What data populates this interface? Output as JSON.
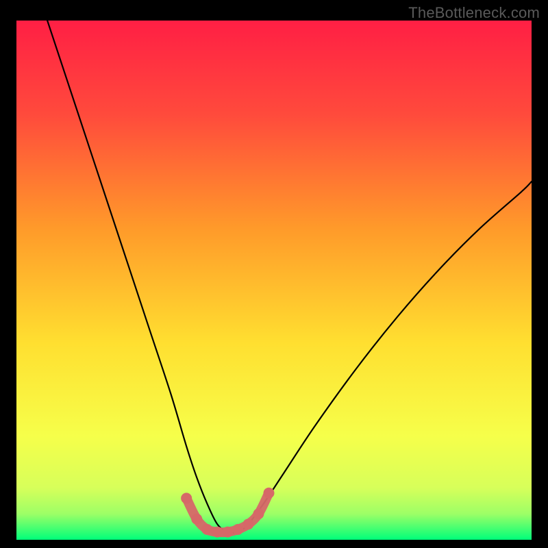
{
  "watermark": "TheBottleneck.com",
  "chart_data": {
    "type": "line",
    "title": "",
    "xlabel": "",
    "ylabel": "",
    "xlim": [
      0,
      100
    ],
    "ylim": [
      0,
      100
    ],
    "grid": false,
    "series": [
      {
        "name": "bottleneck-curve",
        "x": [
          6,
          10,
          14,
          18,
          22,
          26,
          30,
          33,
          35,
          37,
          39,
          41,
          43,
          45,
          48,
          52,
          58,
          66,
          74,
          82,
          90,
          98,
          100
        ],
        "y": [
          100,
          88,
          76,
          64,
          52,
          40,
          28,
          18,
          12,
          7,
          3,
          1.5,
          1.5,
          3,
          7,
          13,
          22,
          33,
          43,
          52,
          60,
          67,
          69
        ]
      },
      {
        "name": "sweet-spot-band",
        "x": [
          33,
          35,
          37,
          39,
          41,
          43,
          45,
          47,
          49
        ],
        "y": [
          8,
          4,
          2,
          1.5,
          1.5,
          2,
          3,
          5,
          9
        ]
      }
    ],
    "colors": {
      "curve": "#000000",
      "band": "#d66868",
      "gradient_top": "#ff1f44",
      "gradient_mid1": "#ff8a2a",
      "gradient_mid2": "#ffe63a",
      "gradient_low": "#f2ff66",
      "gradient_bottom": "#00ff7a"
    }
  }
}
